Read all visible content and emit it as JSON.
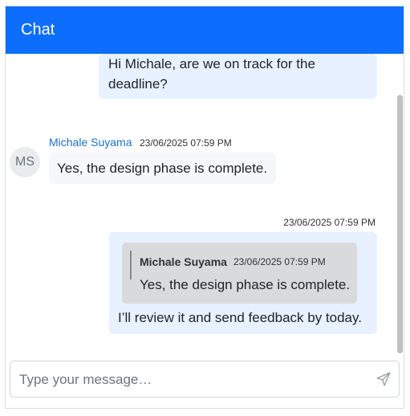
{
  "header": {
    "title": "Chat"
  },
  "messages": [
    {
      "direction": "outgoing",
      "text": "Hi Michale, are we on track for the deadline?"
    },
    {
      "direction": "incoming",
      "avatar_initials": "MS",
      "sender": "Michale Suyama",
      "time": "23/06/2025 07:59 PM",
      "text": "Yes, the design phase is complete."
    },
    {
      "direction": "outgoing",
      "time": "23/06/2025 07:59 PM",
      "quote": {
        "sender": "Michale Suyama",
        "time": "23/06/2025 07:59 PM",
        "text": "Yes, the design phase is complete."
      },
      "text": "I’ll review it and send feedback by today."
    }
  ],
  "composer": {
    "placeholder": "Type your message…",
    "send_icon": "send-icon"
  },
  "colors": {
    "header_bg": "#0d6efd",
    "outgoing_bubble": "#e7f1ff",
    "incoming_bubble": "#f6f7f8",
    "quote_bg": "#d9dadb",
    "sender_name": "#1a73c8"
  }
}
